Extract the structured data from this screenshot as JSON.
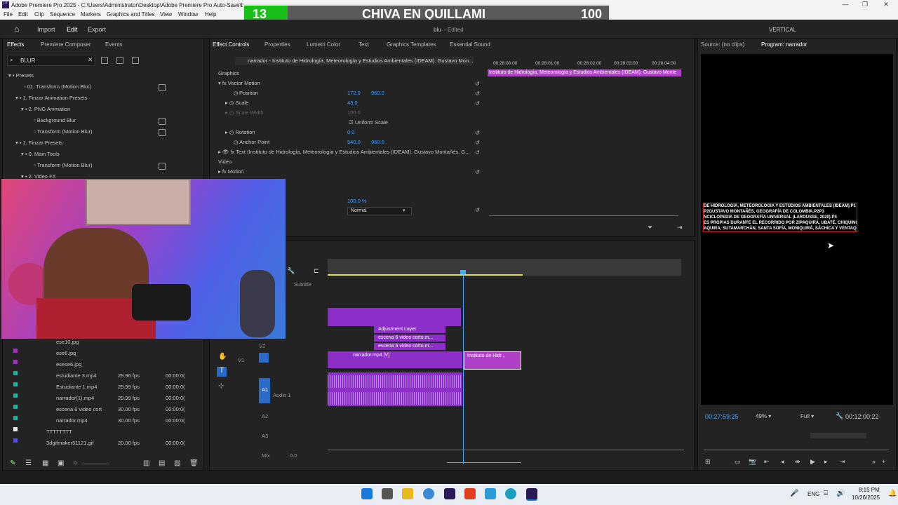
{
  "window": {
    "title": "Adobe Premiere Pro 2025 - C:\\Users\\Administrator\\Desktop\\Adobe Premiere Pro Auto-Save\\b",
    "controls": [
      "—",
      "❐",
      "✕"
    ]
  },
  "menu": [
    "File",
    "Edit",
    "Clip",
    "Sequence",
    "Markers",
    "Graphics and Titles",
    "View",
    "Window",
    "Help"
  ],
  "scoreboard": {
    "left": "13",
    "center": "CHIVA EN QUILLAMI",
    "right": "100"
  },
  "topnav": {
    "home_icon": "home-icon",
    "import": "Import",
    "edit": "Edit",
    "export": "Export",
    "project": "blu",
    "edited": "- Edited",
    "workspace": "VERTICAL"
  },
  "effects_panel": {
    "tabs": [
      "Effects",
      "Premiere Composer",
      "Events"
    ],
    "search_value": "BLUR",
    "tree": [
      {
        "label": "Presets"
      },
      {
        "label": "01. Transform (Motion Blur)"
      },
      {
        "label": "1. Finzar Animation Presets"
      },
      {
        "label": "2. PNG Animation"
      },
      {
        "label": "Background Blur"
      },
      {
        "label": "Transform (Motion Blur)"
      },
      {
        "label": "1. Finzar Presets"
      },
      {
        "label": "0. Main Tools"
      },
      {
        "label": "Transform (Motion Blur)"
      },
      {
        "label": "2. Video FX"
      }
    ]
  },
  "project_list": {
    "items": [
      {
        "name": "ese10.jpg",
        "fps": "",
        "dur": ""
      },
      {
        "name": "ese6.jpg",
        "fps": "",
        "dur": ""
      },
      {
        "name": "esese6.jpg",
        "fps": "",
        "dur": ""
      },
      {
        "name": "estudiante 3.mp4",
        "fps": "29.96 fps",
        "dur": "00:00:0("
      },
      {
        "name": "Estudiante 1.mp4",
        "fps": "29.99 fps",
        "dur": "00:00:0("
      },
      {
        "name": "narrador(1).mp4",
        "fps": "29.99 fps",
        "dur": "00:00:0("
      },
      {
        "name": "escena 6 video cort",
        "fps": "30.00 fps",
        "dur": "00:00:0("
      },
      {
        "name": "narrador.mp4",
        "fps": "30.00 fps",
        "dur": "00:00:0("
      },
      {
        "name": "TTTTTTTT",
        "fps": "",
        "dur": ""
      },
      {
        "name": "3dgifmaker51121.gif",
        "fps": "20.00 fps",
        "dur": "00:00:0("
      }
    ]
  },
  "effect_controls": {
    "tabs": [
      "Effect Controls",
      "Properties",
      "Lumetri Color",
      "Text",
      "Graphics Templates",
      "Essential Sound"
    ],
    "clip_name": "narrador - Instituto de Hidrología, Meteorología y Estudios Ambientales (IDEAM). Gustavo Mon...",
    "section_graphics": "Graphics",
    "vector_motion": "Vector Motion",
    "position_label": "Position",
    "position_x": "172.0",
    "position_y": "960.0",
    "scale_label": "Scale",
    "scale_value": "43.0",
    "scale_width_label": "Scale Width",
    "scale_width_value": "100.0",
    "uniform_scale": "Uniform Scale",
    "rotation_label": "Rotation",
    "rotation_value": "0.0",
    "anchor_label": "Anchor Point",
    "anchor_x": "540.0",
    "anchor_y": "960.0",
    "text_layer": "Text (Instituto de Hidrología, Meteorología y Estudios Ambientales (IDEAM). Gustavo Montañés, G...",
    "section_video": "Video",
    "motion": "Motion",
    "opacity_value": "100.0 %",
    "blend_mode": "Normal",
    "ruler": [
      "00:28:00:00",
      "00:28:01:00",
      "00:28:02:00",
      "00:28:03:00",
      "00:28:04:00"
    ],
    "mini_clip": "Instituto de Hidrología, Meteorología y Estudios Ambientales (IDEAM). Gustavo Monte"
  },
  "program_monitor": {
    "tabs": [
      "Source: (no clips)",
      "Program: narrador"
    ],
    "caption_lines": [
      "DE HIDROLOGÍA, METEOROLOGÍA Y ESTUDIOS AMBIENTALES (IDEAM).P1",
      "P2GUSTAVO MONTAÑÉS, GEOGRAFÍA DE COLOMBIA.P2P3",
      "NCICLOPEDIA DE GEOGRAFÍA UNIVERSAL (LAROUSSE, 2020).P4",
      "ES PROPIAS DURANTE EL RECORRIDO POR ZIPAQUIRÁ, UBATÉ, CHIQUINQUIRÁ,",
      "AQUIRA, SUTAMARCHÁN, SANTA SOFÍA, MONIQUIRÁ, SÁCHICA Y VENTAQUEMADA."
    ],
    "timecode": "00:27:59:25",
    "zoom": "49%",
    "quality": "Full",
    "duration": "00:12:00:22"
  },
  "timeline": {
    "tracks": {
      "subtitle": "Subtitle",
      "v2": "V2",
      "v1": "V1",
      "a1": "A1",
      "audio1": "Audio 1",
      "a2": "A2",
      "a3": "A3",
      "mix": "Mix",
      "mix_value": "0.0"
    },
    "clips": {
      "adjustment": "Adjustment Layer",
      "escena1": "escena 6 video corto.m...",
      "escena2": "escena 6 video corto.m...",
      "narrador": "narrador.mp4 [V]",
      "instituto": "Instituto de Hidr...",
      "fx": "fx"
    }
  },
  "taskbar": {
    "lang": "ENG",
    "time": "8:15 PM",
    "date": "10/26/2025"
  }
}
